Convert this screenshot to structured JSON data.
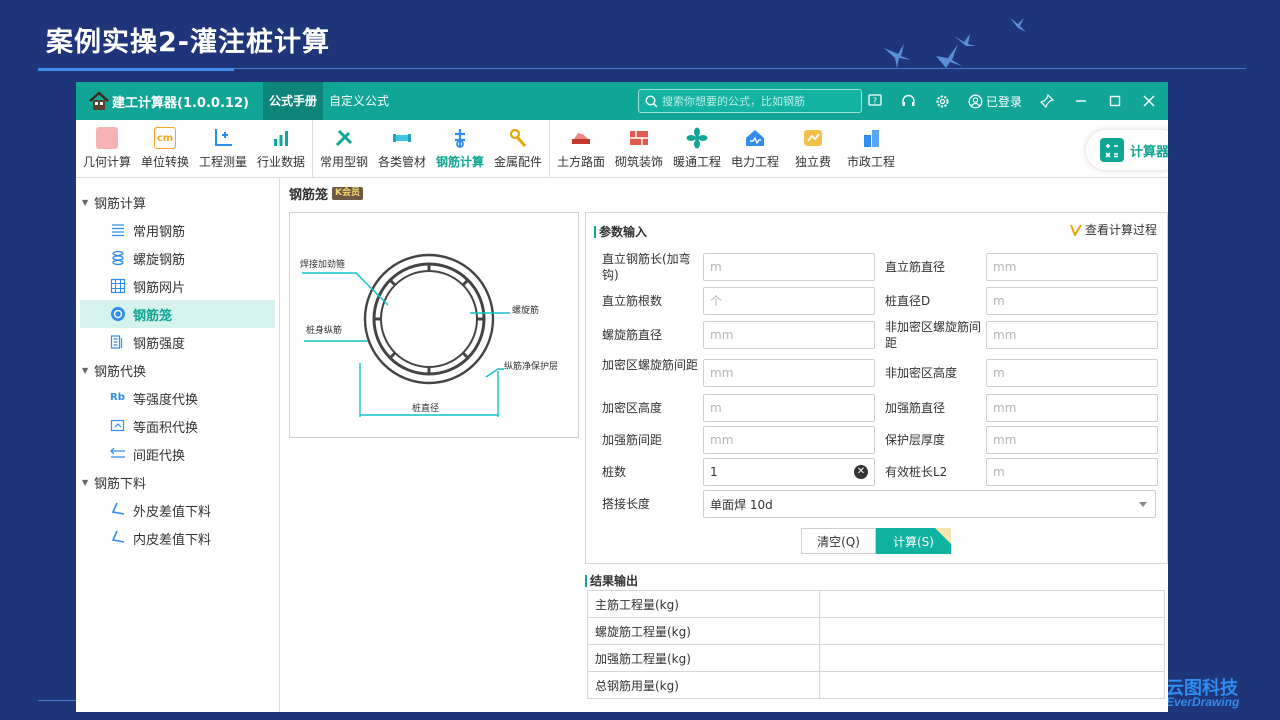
{
  "slide": {
    "title": "案例实操2-灌注桩计算",
    "brand": "云图科技",
    "brand_sub": "EverDrawing"
  },
  "app": {
    "name": "建工计算器(1.0.0.12)",
    "tabs": [
      {
        "label": "公式手册",
        "active": true
      },
      {
        "label": "自定义公式",
        "active": false
      }
    ],
    "search_placeholder": "搜索你想要的公式，比如钢筋",
    "login_label": "已登录",
    "accent_color": "#10a595"
  },
  "toolbar": {
    "groups": [
      [
        {
          "label": "几何计算",
          "icon": "cube-icon",
          "color": "#f08a8a"
        },
        {
          "label": "单位转换",
          "icon": "cm-icon",
          "color": "#f5a623"
        },
        {
          "label": "工程测量",
          "icon": "axis-icon",
          "color": "#2f8cf0"
        },
        {
          "label": "行业数据",
          "icon": "bar-chart-icon",
          "color": "#10a595"
        }
      ],
      [
        {
          "label": "常用型钢",
          "icon": "tools-icon",
          "color": "#10a595"
        },
        {
          "label": "各类管材",
          "icon": "pipe-icon",
          "color": "#3ec5e0"
        },
        {
          "label": "钢筋计算",
          "icon": "rebar-icon",
          "color": "#2f8cf0",
          "active": true
        },
        {
          "label": "金属配件",
          "icon": "hardware-icon",
          "color": "#e6a700"
        }
      ],
      [
        {
          "label": "土方路面",
          "icon": "earthwork-icon",
          "color": "#c0392b"
        },
        {
          "label": "砌筑装饰",
          "icon": "brick-icon",
          "color": "#e05a4f"
        },
        {
          "label": "暖通工程",
          "icon": "fan-icon",
          "color": "#10a595"
        },
        {
          "label": "电力工程",
          "icon": "power-icon",
          "color": "#2f8cf0"
        },
        {
          "label": "独立费",
          "icon": "coins-icon",
          "color": "#f5a623"
        },
        {
          "label": "市政工程",
          "icon": "building-icon",
          "color": "#2f8cf0"
        }
      ]
    ],
    "calculator_label": "计算器"
  },
  "sidebar": {
    "groups": [
      {
        "label": "钢筋计算",
        "items": [
          {
            "label": "常用钢筋",
            "icon": "lines-icon",
            "active": false
          },
          {
            "label": "螺旋钢筋",
            "icon": "spiral-icon",
            "active": false
          },
          {
            "label": "钢筋网片",
            "icon": "grid-icon",
            "active": false
          },
          {
            "label": "钢筋笼",
            "icon": "cage-icon",
            "active": true
          },
          {
            "label": "钢筋强度",
            "icon": "strength-icon",
            "active": false
          }
        ]
      },
      {
        "label": "钢筋代换",
        "items": [
          {
            "label": "等强度代换",
            "icon": "rb-icon",
            "active": false
          },
          {
            "label": "等面积代换",
            "icon": "area-icon",
            "active": false
          },
          {
            "label": "间距代换",
            "icon": "spacing-icon",
            "active": false
          }
        ]
      },
      {
        "label": "钢筋下料",
        "items": [
          {
            "label": "外皮差值下料",
            "icon": "bend-icon",
            "active": false
          },
          {
            "label": "内皮差值下料",
            "icon": "bend-icon",
            "active": false
          }
        ]
      }
    ]
  },
  "main": {
    "title": "钢筋笼",
    "vip_tag": "K会员",
    "diagram": {
      "label_hoop": "焊接加劲箍",
      "label_spiral": "螺旋筋",
      "label_long": "桩身纵筋",
      "label_cover": "纵筋净保护层",
      "label_dia": "桩直径"
    },
    "params": {
      "title": "参数输入",
      "view_process": "查看计算过程",
      "fields": [
        {
          "label": "直立钢筋长(加弯钩)",
          "placeholder": "m",
          "value": ""
        },
        {
          "label": "直立筋直径",
          "placeholder": "mm",
          "value": ""
        },
        {
          "label": "直立筋根数",
          "placeholder": "个",
          "value": ""
        },
        {
          "label": "桩直径D",
          "placeholder": "m",
          "value": ""
        },
        {
          "label": "螺旋筋直径",
          "placeholder": "mm",
          "value": ""
        },
        {
          "label": "非加密区螺旋筋间距",
          "placeholder": "mm",
          "value": ""
        },
        {
          "label": "加密区螺旋筋间距",
          "placeholder": "mm",
          "value": ""
        },
        {
          "label": "非加密区高度",
          "placeholder": "m",
          "value": ""
        },
        {
          "label": "加密区高度",
          "placeholder": "m",
          "value": ""
        },
        {
          "label": "加强筋直径",
          "placeholder": "mm",
          "value": ""
        },
        {
          "label": "加强筋间距",
          "placeholder": "mm",
          "value": ""
        },
        {
          "label": "保护层厚度",
          "placeholder": "mm",
          "value": ""
        },
        {
          "label": "桩数",
          "placeholder": "",
          "value": "1"
        },
        {
          "label": "有效桩长L2",
          "placeholder": "m",
          "value": ""
        }
      ],
      "lap_label": "搭接长度",
      "lap_value": "单面焊 10d",
      "clear_label": "清空(Q)",
      "calc_label": "计算(S)"
    },
    "results": {
      "title": "结果输出",
      "rows": [
        {
          "label": "主筋工程量(kg)",
          "value": ""
        },
        {
          "label": "螺旋筋工程量(kg)",
          "value": ""
        },
        {
          "label": "加强筋工程量(kg)",
          "value": ""
        },
        {
          "label": "总钢筋用量(kg)",
          "value": ""
        }
      ]
    }
  }
}
